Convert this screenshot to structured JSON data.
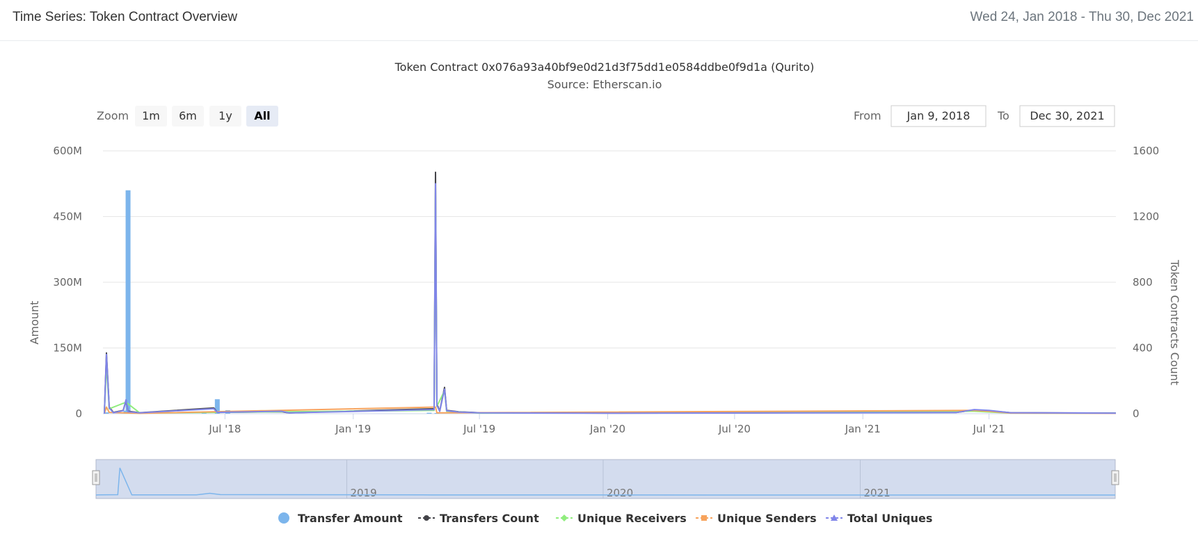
{
  "header": {
    "title": "Time Series: Token Contract Overview",
    "date_range": "Wed 24, Jan 2018 - Thu 30, Dec 2021"
  },
  "range_selector": {
    "zoom_label": "Zoom",
    "buttons": [
      "1m",
      "6m",
      "1y",
      "All"
    ],
    "active": "All",
    "from_label": "From",
    "from_value": "Jan 9, 2018",
    "to_label": "To",
    "to_value": "Dec 30, 2021"
  },
  "colors": {
    "transfer_amount": "#7cb5ec",
    "transfers_count": "#434348",
    "unique_receivers": "#90ed7d",
    "unique_senders": "#f7a35c",
    "total_uniques": "#8085e9",
    "navigator_fill": "#d3dcee",
    "grid": "#e6e6e6"
  },
  "chart_data": {
    "type": "line",
    "title": "Token Contract 0x076a93a40bf9e0d21d3f75dd1e0584ddbe0f9d1a (Qurito)",
    "subtitle": "Source: Etherscan.io",
    "x_range": [
      "2018-01-09",
      "2021-12-30"
    ],
    "x_ticks": [
      {
        "date": "2018-07-01",
        "label": "Jul '18"
      },
      {
        "date": "2019-01-01",
        "label": "Jan '19"
      },
      {
        "date": "2019-07-01",
        "label": "Jul '19"
      },
      {
        "date": "2020-01-01",
        "label": "Jan '20"
      },
      {
        "date": "2020-07-01",
        "label": "Jul '20"
      },
      {
        "date": "2021-01-01",
        "label": "Jan '21"
      },
      {
        "date": "2021-07-01",
        "label": "Jul '21"
      }
    ],
    "y_left": {
      "label": "Amount",
      "range": [
        0,
        600000000
      ],
      "ticks": [
        0,
        150000000,
        300000000,
        450000000,
        600000000
      ],
      "tick_labels": [
        "0",
        "150M",
        "300M",
        "450M",
        "600M"
      ]
    },
    "y_right": {
      "label": "Token Contracts Count",
      "range": [
        0,
        1600
      ],
      "ticks": [
        0,
        400,
        800,
        1200,
        1600
      ],
      "tick_labels": [
        "0",
        "400",
        "800",
        "1200",
        "1600"
      ]
    },
    "grid": true,
    "legend_position": "bottom-center",
    "navigator_labels": [
      {
        "date": "2019-01-01",
        "label": "2019"
      },
      {
        "date": "2020-01-01",
        "label": "2020"
      },
      {
        "date": "2021-01-01",
        "label": "2021"
      }
    ],
    "series": [
      {
        "name": "Transfer Amount",
        "type": "column",
        "axis": "left",
        "points": [
          [
            "2018-01-12",
            3000000
          ],
          [
            "2018-02-09",
            7000000
          ],
          [
            "2018-02-12",
            510000000
          ],
          [
            "2018-03-01",
            2000000
          ],
          [
            "2018-06-01",
            3000000
          ],
          [
            "2018-06-20",
            33000000
          ],
          [
            "2018-07-05",
            8000000
          ],
          [
            "2019-04-20",
            2000000
          ],
          [
            "2019-05-01",
            1500000
          ]
        ]
      },
      {
        "name": "Transfers Count",
        "type": "line",
        "axis": "right",
        "points": [
          [
            "2018-01-09",
            0
          ],
          [
            "2018-01-12",
            370
          ],
          [
            "2018-01-16",
            40
          ],
          [
            "2018-01-22",
            8
          ],
          [
            "2018-02-05",
            20
          ],
          [
            "2018-02-09",
            80
          ],
          [
            "2018-02-12",
            15
          ],
          [
            "2018-03-01",
            6
          ],
          [
            "2018-06-15",
            35
          ],
          [
            "2018-06-20",
            8
          ],
          [
            "2018-09-20",
            12
          ],
          [
            "2018-10-01",
            5
          ],
          [
            "2019-04-27",
            30
          ],
          [
            "2019-04-29",
            1470
          ],
          [
            "2019-05-01",
            60
          ],
          [
            "2019-05-05",
            15
          ],
          [
            "2019-05-12",
            160
          ],
          [
            "2019-05-15",
            20
          ],
          [
            "2019-06-01",
            12
          ],
          [
            "2019-07-01",
            6
          ],
          [
            "2020-01-01",
            4
          ],
          [
            "2021-05-15",
            8
          ],
          [
            "2021-06-10",
            22
          ],
          [
            "2021-07-01",
            18
          ],
          [
            "2021-08-01",
            6
          ],
          [
            "2021-12-30",
            4
          ]
        ]
      },
      {
        "name": "Unique Receivers",
        "type": "line",
        "axis": "right",
        "points": [
          [
            "2018-01-09",
            0
          ],
          [
            "2018-01-12",
            300
          ],
          [
            "2018-01-16",
            30
          ],
          [
            "2018-02-09",
            70
          ],
          [
            "2018-03-01",
            4
          ],
          [
            "2019-04-27",
            20
          ],
          [
            "2019-04-29",
            1380
          ],
          [
            "2019-05-01",
            45
          ],
          [
            "2019-05-12",
            140
          ],
          [
            "2019-05-15",
            15
          ],
          [
            "2019-07-01",
            4
          ],
          [
            "2021-06-10",
            15
          ],
          [
            "2021-08-01",
            4
          ],
          [
            "2021-12-30",
            3
          ]
        ]
      },
      {
        "name": "Unique Senders",
        "type": "line",
        "axis": "right",
        "points": [
          [
            "2018-01-09",
            0
          ],
          [
            "2018-01-12",
            40
          ],
          [
            "2018-01-16",
            8
          ],
          [
            "2018-03-01",
            2
          ],
          [
            "2019-04-29",
            40
          ],
          [
            "2019-05-01",
            5
          ],
          [
            "2021-06-10",
            20
          ],
          [
            "2021-07-01",
            15
          ],
          [
            "2021-08-01",
            4
          ],
          [
            "2021-12-30",
            2
          ]
        ]
      },
      {
        "name": "Total Uniques",
        "type": "line",
        "axis": "right",
        "points": [
          [
            "2018-01-09",
            0
          ],
          [
            "2018-01-12",
            360
          ],
          [
            "2018-01-16",
            35
          ],
          [
            "2018-01-22",
            6
          ],
          [
            "2018-02-05",
            18
          ],
          [
            "2018-02-09",
            85
          ],
          [
            "2018-02-12",
            12
          ],
          [
            "2018-03-01",
            5
          ],
          [
            "2018-06-15",
            30
          ],
          [
            "2018-06-20",
            8
          ],
          [
            "2018-09-20",
            15
          ],
          [
            "2018-10-01",
            5
          ],
          [
            "2019-04-27",
            25
          ],
          [
            "2019-04-29",
            1400
          ],
          [
            "2019-05-01",
            50
          ],
          [
            "2019-05-05",
            15
          ],
          [
            "2019-05-12",
            150
          ],
          [
            "2019-05-15",
            18
          ],
          [
            "2019-06-01",
            10
          ],
          [
            "2019-07-01",
            5
          ],
          [
            "2020-01-01",
            3
          ],
          [
            "2021-05-15",
            7
          ],
          [
            "2021-06-10",
            25
          ],
          [
            "2021-07-01",
            20
          ],
          [
            "2021-08-01",
            6
          ],
          [
            "2021-12-30",
            3
          ]
        ]
      }
    ],
    "legend": [
      {
        "name": "Transfer Amount",
        "symbol": "circle"
      },
      {
        "name": "Transfers Count",
        "symbol": "circle-line"
      },
      {
        "name": "Unique Receivers",
        "symbol": "diamond-line"
      },
      {
        "name": "Unique Senders",
        "symbol": "square-line"
      },
      {
        "name": "Total Uniques",
        "symbol": "triangle-line"
      }
    ]
  }
}
